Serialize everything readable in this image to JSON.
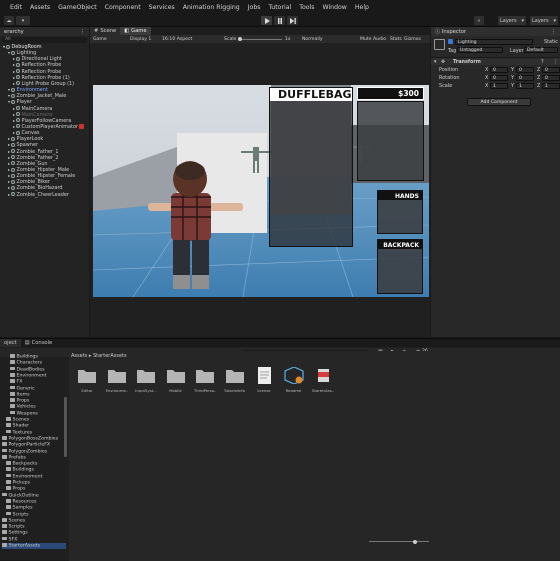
{
  "menu": [
    "Edit",
    "Assets",
    "GameObject",
    "Component",
    "Services",
    "Animation Rigging",
    "Jobs",
    "Tutorial",
    "Tools",
    "Window",
    "Help"
  ],
  "toolbar": {
    "layers": "Layers",
    "layout": "Layers"
  },
  "hierarchy": {
    "tab": "erarchy",
    "search_placeholder": "All",
    "rows": [
      {
        "label": "DebugRoom",
        "indent": 0
      },
      {
        "label": "Lighting",
        "indent": 1
      },
      {
        "label": "Directional Light",
        "indent": 2
      },
      {
        "label": "Reflection Probe",
        "indent": 2
      },
      {
        "label": "Reflection Probe",
        "indent": 2
      },
      {
        "label": "Reflection Probe (1)",
        "indent": 2
      },
      {
        "label": "Light Probe Group (1)",
        "indent": 2
      },
      {
        "label": "Environment",
        "indent": 1
      },
      {
        "label": "Zombie_Jacket_Male",
        "indent": 1
      },
      {
        "label": "Player",
        "indent": 1
      },
      {
        "label": "MainCamera",
        "indent": 2
      },
      {
        "label": "MainCamera",
        "indent": 2
      },
      {
        "label": "PlayerFollowCamera",
        "indent": 2
      },
      {
        "label": "CustomPlayerAnimator",
        "indent": 2
      },
      {
        "label": "Canvas",
        "indent": 2
      },
      {
        "label": "PlayerLook",
        "indent": 1
      },
      {
        "label": "Spawner",
        "indent": 1
      },
      {
        "label": "Zombie_Father_1",
        "indent": 1
      },
      {
        "label": "Zombie_Father_2",
        "indent": 1
      },
      {
        "label": "Zombie_Gun",
        "indent": 1
      },
      {
        "label": "Zombie_Hipster_Male",
        "indent": 1
      },
      {
        "label": "Zombie_Hipster_Female",
        "indent": 1
      },
      {
        "label": "Zombie_Biker",
        "indent": 1
      },
      {
        "label": "Zombie_BioHazard",
        "indent": 1
      },
      {
        "label": "Zombie_CheerLeader",
        "indent": 1
      }
    ]
  },
  "scene": {
    "tabs": [
      "Scene",
      "Game"
    ],
    "game_toolbar": {
      "display": "Game",
      "display_n": "Display 1",
      "aspect": "16:10 Aspect",
      "scale_label": "Scale",
      "scale_value": "1x",
      "mode": "Normally",
      "mute": "Mute Audio",
      "stats": "Stats",
      "gizmos": "Gizmos"
    },
    "hud": {
      "title": "DUFFLEBAG",
      "money": "$300",
      "hands": "HANDS",
      "backpack": "BACKPACK"
    }
  },
  "inspector": {
    "tab": "Inspector",
    "object_name": "Lighting",
    "static": "Static",
    "tag_label": "Tag",
    "tag_value": "Untagged",
    "layer_label": "Layer",
    "layer_value": "Default",
    "component": "Transform",
    "rows": [
      {
        "label": "Position",
        "x": "0",
        "y": "0",
        "z": "0"
      },
      {
        "label": "Rotation",
        "x": "0",
        "y": "0",
        "z": "0"
      },
      {
        "label": "Scale",
        "x": "1",
        "y": "1",
        "z": "1"
      }
    ],
    "add_component": "Add Component"
  },
  "project": {
    "tabs": [
      "oject",
      "Console"
    ],
    "breadcrumb": [
      "Assets",
      "StarterAssets"
    ],
    "badge": "26",
    "tree": [
      {
        "label": "Buildings",
        "indent": 2
      },
      {
        "label": "Characters",
        "indent": 2
      },
      {
        "label": "DeadBodies",
        "indent": 2
      },
      {
        "label": "Environment",
        "indent": 2
      },
      {
        "label": "FX",
        "indent": 2
      },
      {
        "label": "Generic",
        "indent": 2
      },
      {
        "label": "Items",
        "indent": 2
      },
      {
        "label": "Props",
        "indent": 2
      },
      {
        "label": "Vehicles",
        "indent": 2
      },
      {
        "label": "Weapons",
        "indent": 2
      },
      {
        "label": "Scenes",
        "indent": 1
      },
      {
        "label": "Shader",
        "indent": 1
      },
      {
        "label": "Textures",
        "indent": 1
      },
      {
        "label": "PolygonBossZombies",
        "indent": 0
      },
      {
        "label": "PolygonParticleFX",
        "indent": 0
      },
      {
        "label": "PolygonZombies",
        "indent": 0
      },
      {
        "label": "Prefabs",
        "indent": 0
      },
      {
        "label": "Backpacks",
        "indent": 1
      },
      {
        "label": "Buildings",
        "indent": 1
      },
      {
        "label": "Environment",
        "indent": 1
      },
      {
        "label": "Pickups",
        "indent": 1
      },
      {
        "label": "Props",
        "indent": 1
      },
      {
        "label": "QuickOutline",
        "indent": 0
      },
      {
        "label": "Resources",
        "indent": 1
      },
      {
        "label": "Samples",
        "indent": 1
      },
      {
        "label": "Scripts",
        "indent": 1
      },
      {
        "label": "Scenes",
        "indent": 0
      },
      {
        "label": "Scripts",
        "indent": 0
      },
      {
        "label": "Settings",
        "indent": 0
      },
      {
        "label": "SFX",
        "indent": 0
      },
      {
        "label": "StarterAssets",
        "indent": 0
      }
    ],
    "assets": [
      {
        "label": "Editor",
        "kind": "folder"
      },
      {
        "label": "Environme...",
        "kind": "folder"
      },
      {
        "label": "InputSyst...",
        "kind": "folder"
      },
      {
        "label": "Mobile",
        "kind": "folder"
      },
      {
        "label": "ThirdPerso...",
        "kind": "folder"
      },
      {
        "label": "TutorialInfo",
        "kind": "folder"
      },
      {
        "label": "license",
        "kind": "doc"
      },
      {
        "label": "Readme",
        "kind": "readme"
      },
      {
        "label": "StarterAss...",
        "kind": "package"
      }
    ]
  }
}
